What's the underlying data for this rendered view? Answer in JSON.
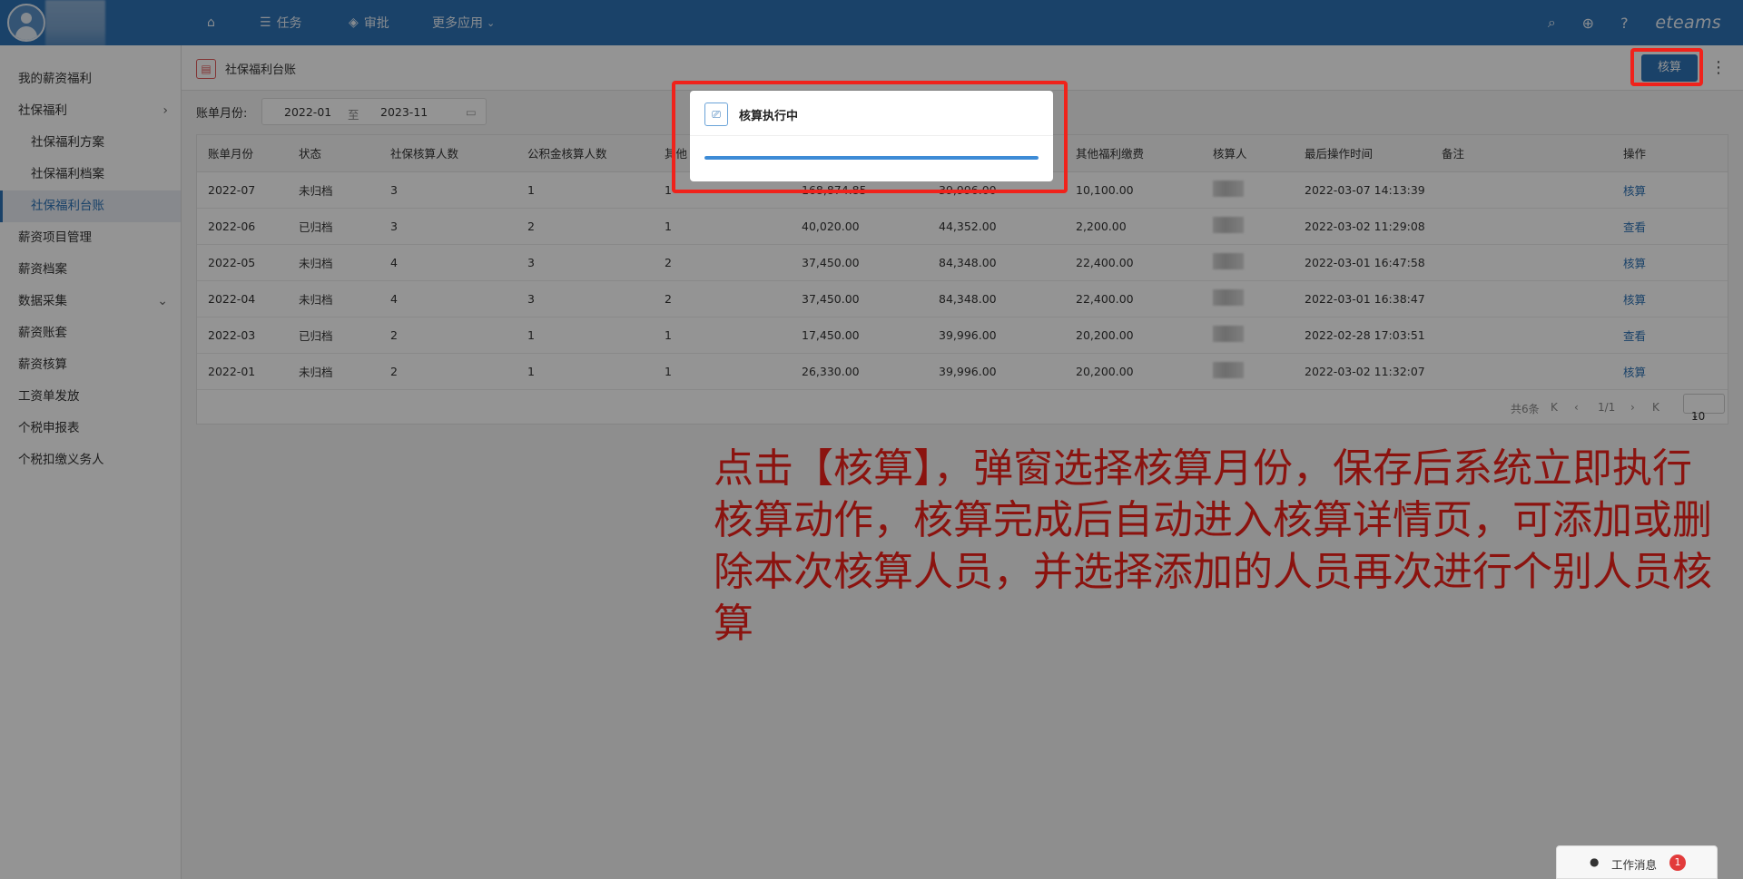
{
  "topbar": {
    "nav": [
      {
        "label": "",
        "icon": "home-icon"
      },
      {
        "label": "任务",
        "icon": "list-icon"
      },
      {
        "label": "审批",
        "icon": "layers-icon"
      },
      {
        "label": "更多应用",
        "icon": "chevron-down-icon"
      }
    ],
    "brand": "eteams",
    "right_icons": [
      "search-icon",
      "plus-circle-icon",
      "help-icon"
    ],
    "color": "#2d72b5"
  },
  "sidebar": {
    "items": [
      {
        "label": "我的薪资福利",
        "level": 1
      },
      {
        "label": "社保福利",
        "level": 1,
        "expand": "›"
      },
      {
        "label": "社保福利方案",
        "level": 2
      },
      {
        "label": "社保福利档案",
        "level": 2
      },
      {
        "label": "社保福利台账",
        "level": 2,
        "active": true
      },
      {
        "label": "薪资项目管理",
        "level": 1
      },
      {
        "label": "薪资档案",
        "level": 1
      },
      {
        "label": "数据采集",
        "level": 1,
        "expand": "⌄"
      },
      {
        "label": "薪资账套",
        "level": 1
      },
      {
        "label": "薪资核算",
        "level": 1
      },
      {
        "label": "工资单发放",
        "level": 1
      },
      {
        "label": "个税申报表",
        "level": 1
      },
      {
        "label": "个税扣缴义务人",
        "level": 1
      }
    ],
    "toggle": "‹"
  },
  "page": {
    "title": "社保福利台账",
    "calc_button": "核算",
    "more": "⋮"
  },
  "filter": {
    "label": "账单月份:",
    "from": "2022-01",
    "sep": "至",
    "to": "2023-11"
  },
  "table": {
    "headers": [
      "账单月份",
      "状态",
      "社保核算人数",
      "公积金核算人数",
      "其他",
      "",
      "",
      "其他福利缴费",
      "核算人",
      "最后操作时间",
      "备注",
      "操作"
    ],
    "rows": [
      {
        "month": "2022-07",
        "status": "未归档",
        "ss": "3",
        "hf": "1",
        "other": "1",
        "c1": "168,874.85",
        "c2": "39,996.00",
        "c3": "10,100.00",
        "time": "2022-03-07 14:13:39",
        "note": "",
        "action": "核算"
      },
      {
        "month": "2022-06",
        "status": "已归档",
        "ss": "3",
        "hf": "2",
        "other": "1",
        "c1": "40,020.00",
        "c2": "44,352.00",
        "c3": "2,200.00",
        "time": "2022-03-02 11:29:08",
        "note": "",
        "action": "查看"
      },
      {
        "month": "2022-05",
        "status": "未归档",
        "ss": "4",
        "hf": "3",
        "other": "2",
        "c1": "37,450.00",
        "c2": "84,348.00",
        "c3": "22,400.00",
        "time": "2022-03-01 16:47:58",
        "note": "",
        "action": "核算"
      },
      {
        "month": "2022-04",
        "status": "未归档",
        "ss": "4",
        "hf": "3",
        "other": "2",
        "c1": "37,450.00",
        "c2": "84,348.00",
        "c3": "22,400.00",
        "time": "2022-03-01 16:38:47",
        "note": "",
        "action": "核算"
      },
      {
        "month": "2022-03",
        "status": "已归档",
        "ss": "2",
        "hf": "1",
        "other": "1",
        "c1": "17,450.00",
        "c2": "39,996.00",
        "c3": "20,200.00",
        "time": "2022-02-28 17:03:51",
        "note": "",
        "action": "查看"
      },
      {
        "month": "2022-01",
        "status": "未归档",
        "ss": "2",
        "hf": "1",
        "other": "1",
        "c1": "26,330.00",
        "c2": "39,996.00",
        "c3": "20,200.00",
        "time": "2022-03-02 11:32:07",
        "note": "",
        "action": "核算"
      }
    ]
  },
  "pager": {
    "total": "共6条",
    "first": "K",
    "prev": "‹",
    "page": "1/1",
    "next": "›",
    "last": "K",
    "size": "10"
  },
  "modal": {
    "title": "核算执行中",
    "progress": 1.0
  },
  "annotation": {
    "text": "点击【核算】，弹窗选择核算月份，保存后系统立即执行核算动作，核算完成后自动进入核算详情页，可添加或删除本次核算人员，并选择添加的人员再次进行个别人员核算",
    "color": "#f0221b"
  },
  "message": {
    "label": "工作消息",
    "count": "1"
  }
}
